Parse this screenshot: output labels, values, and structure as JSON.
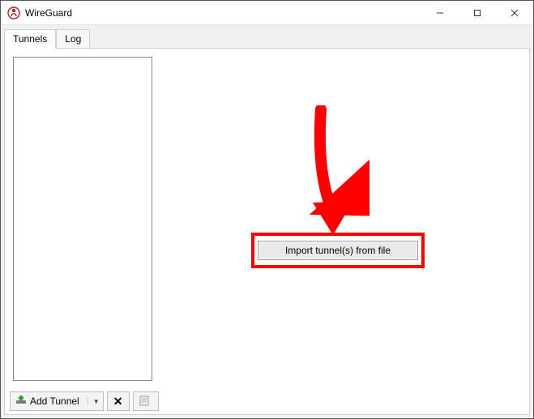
{
  "titlebar": {
    "title": "WireGuard"
  },
  "tabs": {
    "tunnels": "Tunnels",
    "log": "Log"
  },
  "main": {
    "import_button": "Import tunnel(s) from file"
  },
  "toolbar": {
    "add_label": "Add Tunnel",
    "delete_symbol": "✕"
  }
}
